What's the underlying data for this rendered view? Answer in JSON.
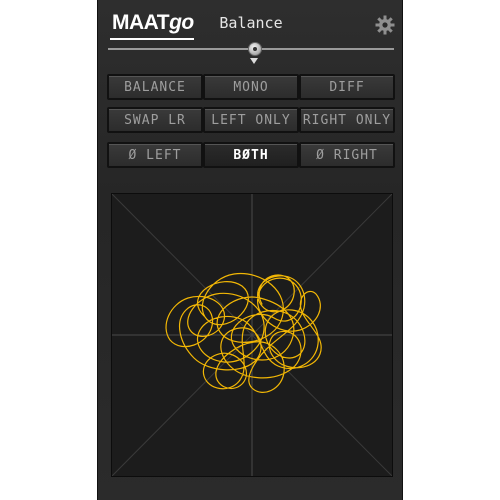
{
  "header": {
    "logo_main": "MAAT",
    "logo_suffix": "go",
    "title": "Balance"
  },
  "icons": {
    "settings": "gear-icon"
  },
  "slider": {
    "value": 0.5
  },
  "buttons": [
    {
      "label": "BALANCE",
      "active": false
    },
    {
      "label": "MONO",
      "active": false
    },
    {
      "label": "DIFF",
      "active": false
    },
    {
      "label": "SWAP LR",
      "active": false
    },
    {
      "label": "LEFT ONLY",
      "active": false
    },
    {
      "label": "RIGHT ONLY",
      "active": false
    },
    {
      "label": "Ø LEFT",
      "active": false
    },
    {
      "label": "BØTH",
      "active": true
    },
    {
      "label": "Ø RIGHT",
      "active": false
    }
  ],
  "colors": {
    "trace": "#f2b705",
    "panel": "#2a2a2a",
    "scope_bg": "#1c1c1c"
  }
}
